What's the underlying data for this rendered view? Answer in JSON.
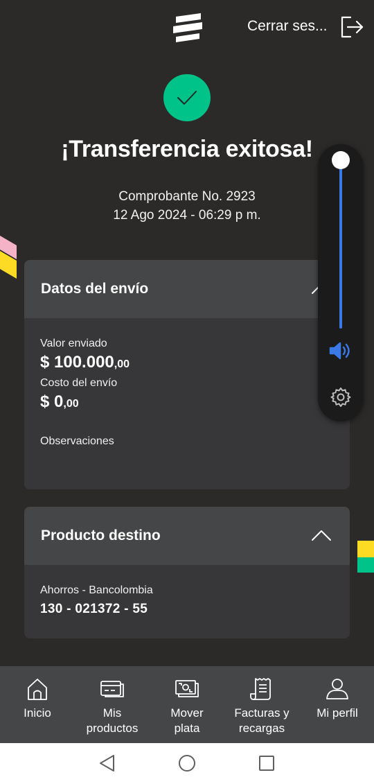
{
  "header": {
    "logo_icon": "bancolombia-logo-icon",
    "logout_label": "Cerrar ses...",
    "logout_icon": "logout-icon"
  },
  "status": {
    "icon": "check-icon",
    "accent_color": "#00c389",
    "title": "¡Transferencia exitosa!",
    "receipt": "Comprobante No. 2923",
    "datetime": "12 Ago 2024 - 06:29 p m."
  },
  "shipping_card": {
    "title": "Datos del envío",
    "value_label": "Valor enviado",
    "value_main": "$ 100.000",
    "value_cents": ",00",
    "cost_label": "Costo del envío",
    "cost_main": "$ 0",
    "cost_cents": ",00",
    "notes_label": "Observaciones"
  },
  "destination_card": {
    "title": "Producto destino",
    "account_type": "Ahorros - Bancolombia",
    "account_number": "130 - 021372 - 55"
  },
  "volume_overlay": {
    "level": 1.0,
    "accent_color": "#3b7ae6",
    "speaker_icon": "speaker-icon",
    "settings_icon": "gear-icon"
  },
  "bottom_nav": {
    "items": [
      {
        "label": "Inicio",
        "icon": "home-icon"
      },
      {
        "label": "Mis\nproductos",
        "icon": "cards-icon"
      },
      {
        "label": "Mover\nplata",
        "icon": "money-icon"
      },
      {
        "label": "Facturas y\nrecargas",
        "icon": "receipt-icon"
      },
      {
        "label": "Mi perfil",
        "icon": "user-icon"
      }
    ]
  },
  "system_nav": {
    "back_icon": "back-triangle-icon",
    "home_icon": "home-circle-icon",
    "recents_icon": "recents-square-icon"
  }
}
